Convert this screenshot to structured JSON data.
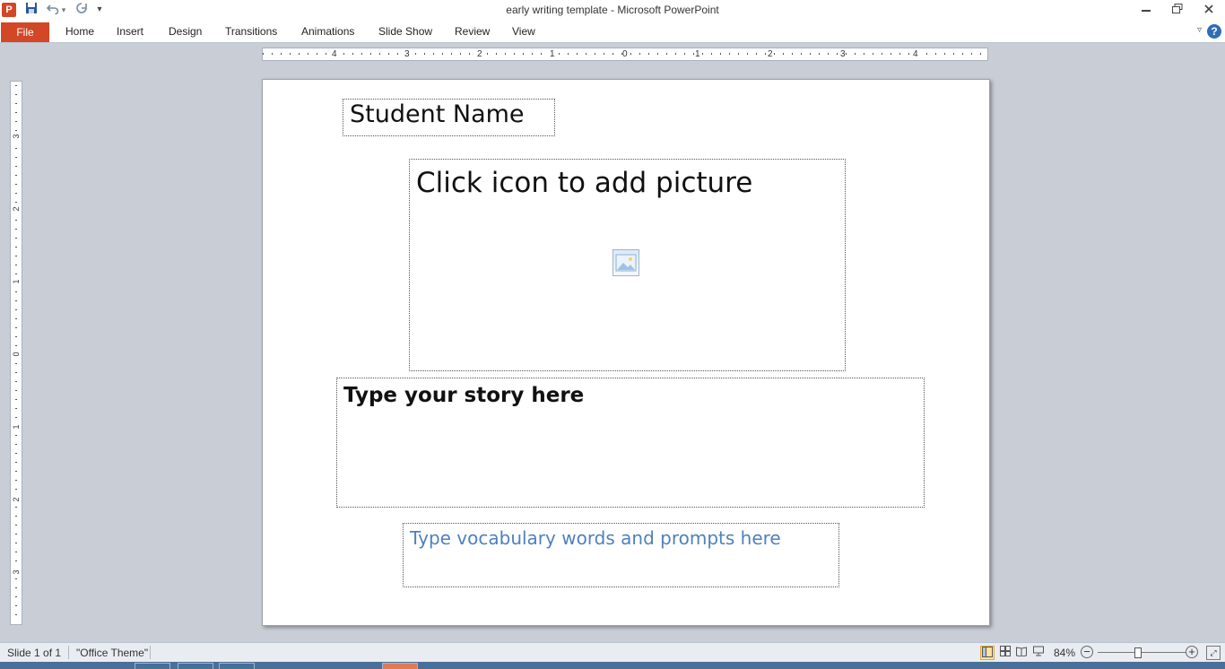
{
  "app": {
    "icon_letter": "P",
    "title": "early writing template  -  Microsoft PowerPoint",
    "brand_color": "#d24726"
  },
  "quick_access": [
    {
      "name": "save-icon",
      "glyph": "💾"
    },
    {
      "name": "undo-icon",
      "glyph": "↶"
    },
    {
      "name": "redo-icon",
      "glyph": "↻"
    },
    {
      "name": "customize-qat-icon",
      "glyph": "▾"
    }
  ],
  "window_controls": {
    "minimize": "▭",
    "restore": "❐",
    "close": "✕"
  },
  "ribbon": {
    "file_label": "File",
    "tabs": [
      "Home",
      "Insert",
      "Design",
      "Transitions",
      "Animations",
      "Slide Show",
      "Review",
      "View"
    ],
    "help": "?",
    "minimize_ribbon": "▿"
  },
  "rulers": {
    "horizontal_labels": [
      "4",
      "3",
      "2",
      "1",
      "0",
      "1",
      "2",
      "3",
      "4"
    ],
    "vertical_labels": [
      "3",
      "2",
      "1",
      "0",
      "1",
      "2",
      "3"
    ]
  },
  "slide": {
    "student_name": "Student Name",
    "picture_prompt": "Click icon to add picture",
    "story_prompt": "Type your story here",
    "vocab_prompt": "Type vocabulary words and prompts here",
    "vocab_color": "#4f81bd"
  },
  "status": {
    "slide_counter": "Slide 1 of 1",
    "theme": "\"Office Theme\"",
    "zoom": "84%",
    "zoom_fraction": 0.42
  },
  "view_buttons": [
    {
      "name": "normal-view-button",
      "glyph": "▣"
    },
    {
      "name": "slide-sorter-button",
      "glyph": "▦"
    },
    {
      "name": "reading-view-button",
      "glyph": "📖"
    },
    {
      "name": "slideshow-button",
      "glyph": "▿"
    }
  ]
}
